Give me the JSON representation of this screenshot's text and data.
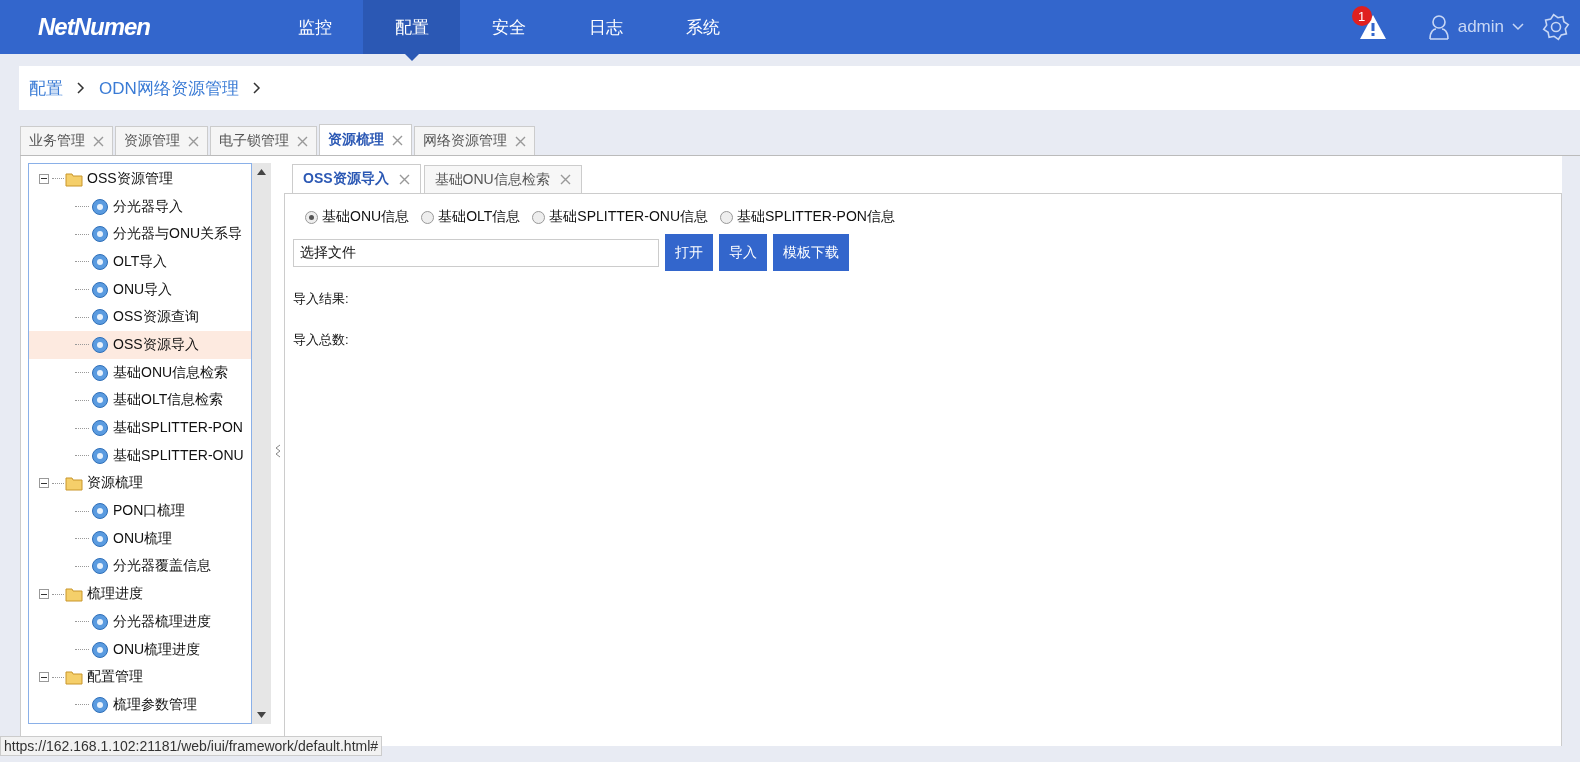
{
  "header": {
    "logo": "NetNumen",
    "nav": [
      {
        "label": "监控",
        "selected": false
      },
      {
        "label": "配置",
        "selected": true
      },
      {
        "label": "安全",
        "selected": false
      },
      {
        "label": "日志",
        "selected": false
      },
      {
        "label": "系统",
        "selected": false
      }
    ],
    "alert_count": "1",
    "user": "admin"
  },
  "breadcrumb": [
    "配置",
    "ODN网络资源管理"
  ],
  "tabs": [
    {
      "label": "业务管理",
      "selected": false
    },
    {
      "label": "资源管理",
      "selected": false
    },
    {
      "label": "电子锁管理",
      "selected": false
    },
    {
      "label": "资源梳理",
      "selected": true
    },
    {
      "label": "网络资源管理",
      "selected": false
    }
  ],
  "tree": [
    {
      "label": "OSS资源管理",
      "expanded": true,
      "children": [
        {
          "label": "分光器导入",
          "selected": false
        },
        {
          "label": "分光器与ONU关系导",
          "selected": false
        },
        {
          "label": "OLT导入",
          "selected": false
        },
        {
          "label": "ONU导入",
          "selected": false
        },
        {
          "label": "OSS资源查询",
          "selected": false
        },
        {
          "label": "OSS资源导入",
          "selected": true
        },
        {
          "label": "基础ONU信息检索",
          "selected": false
        },
        {
          "label": "基础OLT信息检索",
          "selected": false
        },
        {
          "label": "基础SPLITTER-PON",
          "selected": false
        },
        {
          "label": "基础SPLITTER-ONU",
          "selected": false
        }
      ]
    },
    {
      "label": "资源梳理",
      "expanded": true,
      "children": [
        {
          "label": "PON口梳理",
          "selected": false
        },
        {
          "label": "ONU梳理",
          "selected": false
        },
        {
          "label": "分光器覆盖信息",
          "selected": false
        }
      ]
    },
    {
      "label": "梳理进度",
      "expanded": true,
      "children": [
        {
          "label": "分光器梳理进度",
          "selected": false
        },
        {
          "label": "ONU梳理进度",
          "selected": false
        }
      ]
    },
    {
      "label": "配置管理",
      "expanded": true,
      "children": [
        {
          "label": "梳理参数管理",
          "selected": false
        }
      ]
    }
  ],
  "subtabs": [
    {
      "label": "OSS资源导入",
      "selected": true
    },
    {
      "label": "基础ONU信息检索",
      "selected": false
    }
  ],
  "radios": [
    {
      "label": "基础ONU信息",
      "selected": true
    },
    {
      "label": "基础OLT信息",
      "selected": false
    },
    {
      "label": "基础SPLITTER-ONU信息",
      "selected": false
    },
    {
      "label": "基础SPLITTER-PON信息",
      "selected": false
    }
  ],
  "file_field": {
    "value": "选择文件"
  },
  "buttons": [
    "打开",
    "导入",
    "模板下载"
  ],
  "results": [
    "导入结果:",
    "导入总数:"
  ],
  "status_url": "https://162.168.1.102:21181/web/iui/framework/default.html#"
}
